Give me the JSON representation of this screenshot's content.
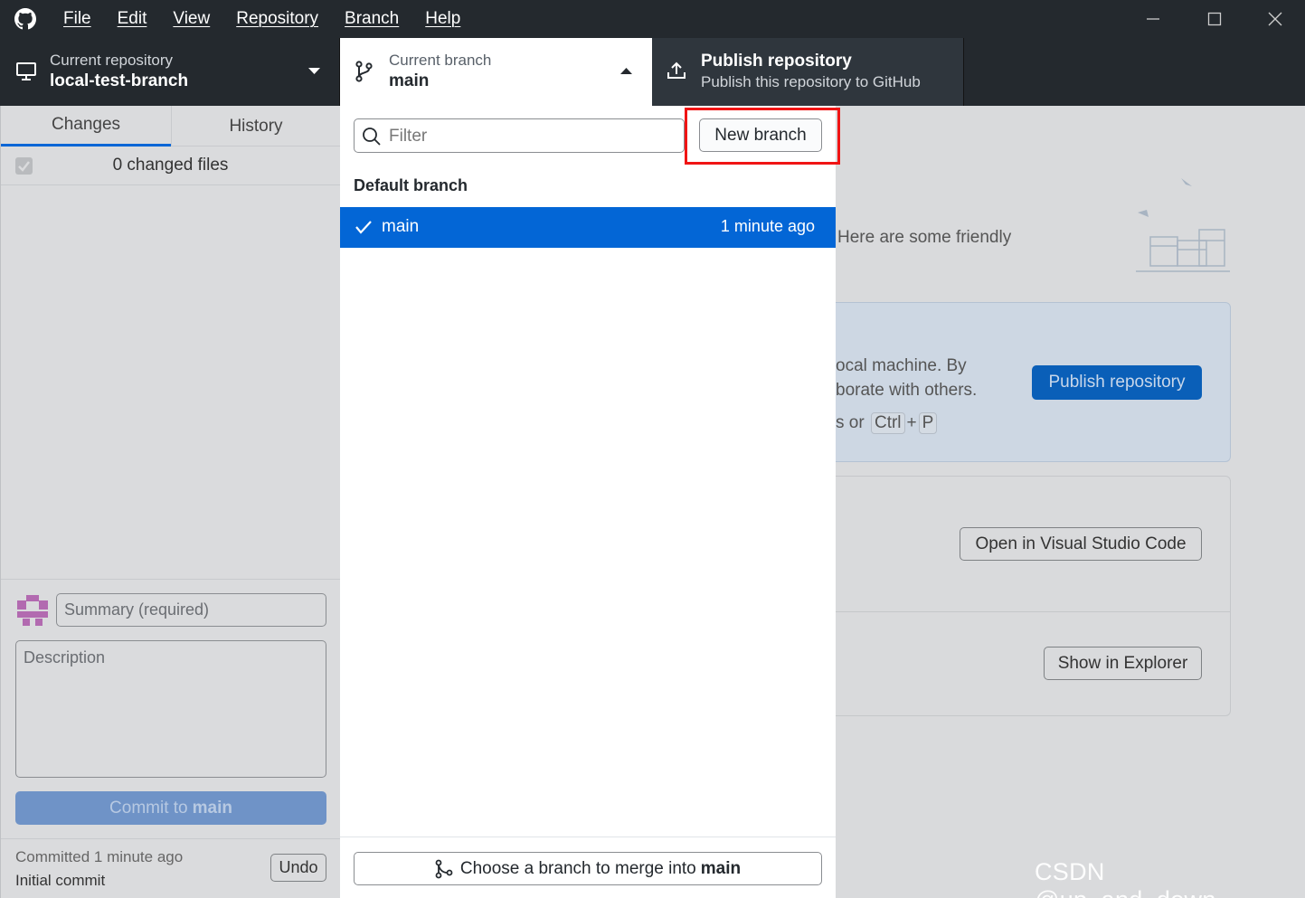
{
  "menu": [
    "File",
    "Edit",
    "View",
    "Repository",
    "Branch",
    "Help"
  ],
  "toolbar": {
    "repo_label": "Current repository",
    "repo_name": "local-test-branch",
    "branch_label": "Current branch",
    "branch_name": "main",
    "publish_title": "Publish repository",
    "publish_subtitle": "Publish this repository to GitHub"
  },
  "sidebar": {
    "tabs": [
      "Changes",
      "History"
    ],
    "changed_files": "0 changed files",
    "summary_placeholder": "Summary (required)",
    "description_placeholder": "Description",
    "commit_prefix": "Commit to",
    "commit_branch": "main",
    "last_commit_time": "Committed 1 minute ago",
    "last_commit_message": "Initial commit",
    "undo_label": "Undo"
  },
  "dropdown": {
    "filter_placeholder": "Filter",
    "new_branch_label": "New branch",
    "group_header": "Default branch",
    "branches": [
      {
        "name": "main",
        "time": "1 minute ago",
        "selected": true
      }
    ],
    "merge_prefix": "Choose a branch to merge into",
    "merge_branch": "main"
  },
  "content": {
    "friendly_text": "Here are some friendly",
    "publish_text1": "ocal machine. By",
    "publish_text2": "borate with others.",
    "publish_text3_prefix": "s or",
    "shortcut_key1": "Ctrl",
    "shortcut_plus": "+",
    "shortcut_key2": "P",
    "publish_button": "Publish repository",
    "vscode_button": "Open in Visual Studio Code",
    "explorer_button": "Show in Explorer"
  },
  "watermark": "CSDN @up_and_down__",
  "colors": {
    "accent": "#0366d6",
    "titlebar": "#24292e",
    "highlight_box": "#f01414"
  }
}
